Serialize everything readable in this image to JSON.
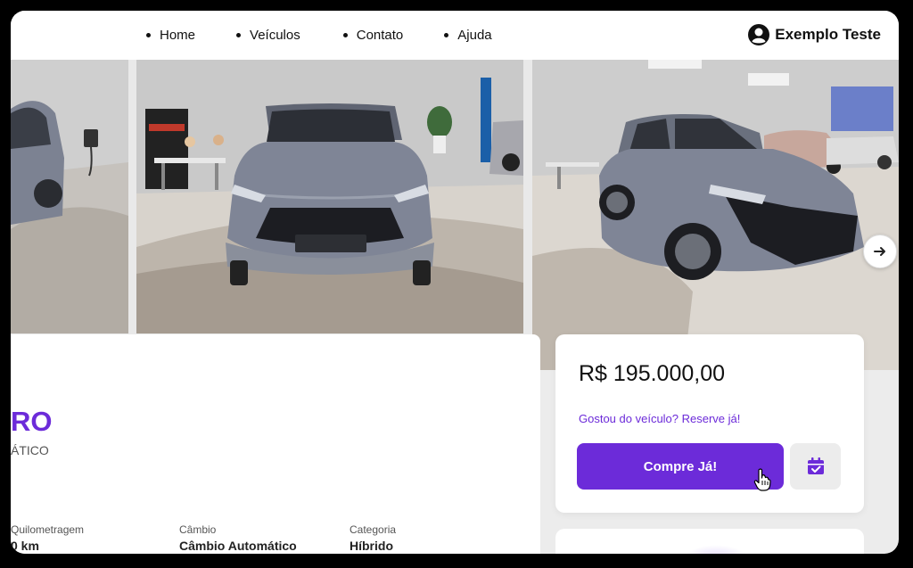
{
  "nav": {
    "items": [
      {
        "label": "Home"
      },
      {
        "label": "Veículos"
      },
      {
        "label": "Contato"
      },
      {
        "label": "Ajuda"
      }
    ]
  },
  "user": {
    "name": "Exemplo Teste",
    "icon": "user-circle-icon"
  },
  "gallery": {
    "photos": [
      {
        "alt": "car-side-partial"
      },
      {
        "alt": "car-front-showroom"
      },
      {
        "alt": "car-three-quarter-showroom"
      }
    ],
    "next_icon": "arrow-right-icon"
  },
  "vehicle": {
    "model": "RO",
    "transmission": "ÁTICO",
    "specs": [
      {
        "label": "Quilometragem",
        "value": "0 km"
      },
      {
        "label": "Câmbio",
        "value": "Câmbio Automático"
      },
      {
        "label": "Categoria",
        "value": "Híbrido"
      }
    ]
  },
  "purchase": {
    "price": "R$ 195.000,00",
    "reserve_text": "Gostou do veículo? Reserve já!",
    "buy_label": "Compre Já!",
    "calendar_icon": "calendar-check-icon"
  },
  "colors": {
    "accent": "#6c2bd9",
    "car_gray": "#7f8596"
  }
}
